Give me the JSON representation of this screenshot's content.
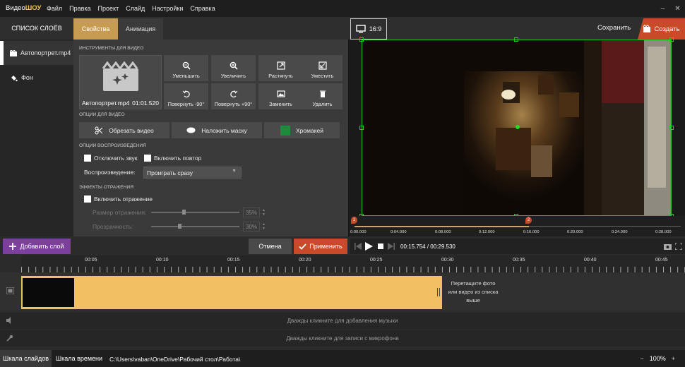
{
  "app": {
    "logo_prefix": "Видео",
    "logo_main": "ШОУ"
  },
  "menu": [
    "Файл",
    "Правка",
    "Проект",
    "Слайд",
    "Настройки",
    "Справка"
  ],
  "window": {
    "minimize": "–",
    "close": "✕"
  },
  "tabs": {
    "layers": "СПИСОК СЛОЁВ",
    "properties": "Свойства",
    "animation": "Анимация"
  },
  "aspect": "16:9",
  "save": "Сохранить",
  "create": "Создать",
  "layers": [
    {
      "name": "Автопортрет.mp4",
      "icon": "film-icon"
    },
    {
      "name": "Фон",
      "icon": "paint-bucket-icon"
    }
  ],
  "tools": {
    "section": "ИНСТРУМЕНТЫ ДЛЯ ВИДЕО",
    "clip_name": "Автопортрет.mp4",
    "clip_duration": "01:01.520",
    "buttons": [
      "Уменьшить",
      "Увеличить",
      "Растянуть",
      "Уместить",
      "Повернуть -90°",
      "Повернуть +90°",
      "Заменить",
      "Удалить"
    ]
  },
  "video_options": {
    "section": "ОПЦИИ ДЛЯ ВИДЕО",
    "trim": "Обрезать видео",
    "mask": "Наложить маску",
    "chroma": "Хромакей",
    "chroma_color": "#1e8a3c"
  },
  "playback": {
    "section": "ОПЦИИ ВОСПРОИЗВЕДЕНИЯ",
    "mute": "Отключить звук",
    "loop": "Включить повтор",
    "label": "Воспроизведение:",
    "value": "Проиграть сразу"
  },
  "reflection": {
    "section": "ЭФФЕКТЫ ОТРАЖЕНИЯ",
    "enable": "Включить отражение",
    "size_label": "Размер отражения:",
    "size_value": "35%",
    "size_fraction": 0.35,
    "opacity_label": "Прозрачность:",
    "opacity_value": "30%",
    "opacity_fraction": 0.3
  },
  "preview_ruler": {
    "labels": [
      "0:00.000",
      "0:04.000",
      "0:08.000",
      "0:12.000",
      "0:16.000",
      "0:20.000",
      "0:24.000",
      "0:28.000"
    ],
    "marker1": "1",
    "marker2": "2"
  },
  "buttons": {
    "add_layer": "Добавить слой",
    "cancel": "Отмена",
    "apply": "Применить"
  },
  "playback_time": "00:15.754 / 00:29.530",
  "timeline": {
    "labels": [
      "00:05",
      "00:10",
      "00:15",
      "00:20",
      "00:25",
      "00:30",
      "00:35",
      "00:40",
      "00:45"
    ],
    "drop_hint": "Перетащите фото или видео из списка выше",
    "music_hint": "Дважды кликните для добавления музыки",
    "mic_hint": "Дважды кликните для записи с микрофона"
  },
  "status": {
    "slides_tab": "Шкала слайдов",
    "time_tab": "Шкала времени",
    "path": "C:\\Users\\vaban\\OneDrive\\Рабочий стол\\Работа\\",
    "zoom": "100%"
  }
}
